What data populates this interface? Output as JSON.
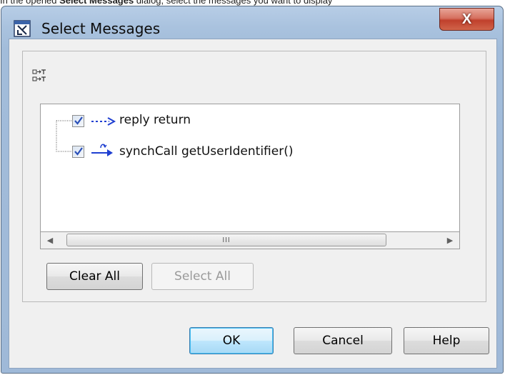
{
  "caption": {
    "before": "In the opened ",
    "bold": "Select Messages",
    "after": " dialog, select the messages you want to display"
  },
  "window": {
    "title": "Select Messages",
    "close_label": "X"
  },
  "tree": {
    "items": [
      {
        "kind": "reply",
        "label": "reply return",
        "checked": true
      },
      {
        "kind": "synchCall",
        "label": "synchCall getUserIdentifier()",
        "checked": true
      }
    ]
  },
  "scrollbar": {
    "left_arrow": "◀",
    "right_arrow": "▶",
    "thumb_grip": "III"
  },
  "buttons": {
    "clear_all": "Clear All",
    "select_all": "Select All",
    "ok": "OK",
    "cancel": "Cancel",
    "help": "Help"
  },
  "colors": {
    "arrow_blue": "#1f3fd1",
    "check_blue": "#2a4fb8"
  },
  "icons": {
    "app": "dialog-icon",
    "toolbar": "expand-message-icon"
  }
}
